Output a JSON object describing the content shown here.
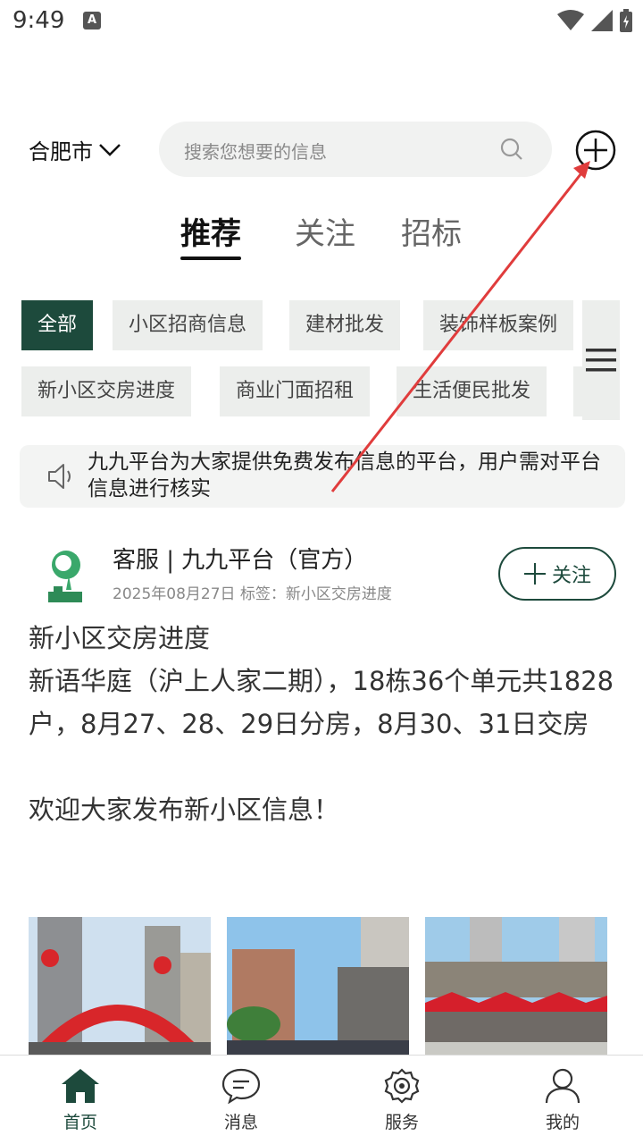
{
  "status_bar": {
    "time": "9:49",
    "badge": "A"
  },
  "header": {
    "city": "合肥市",
    "search_placeholder": "搜索您想要的信息"
  },
  "tabs": [
    {
      "label": "推荐",
      "active": true
    },
    {
      "label": "关注",
      "active": false
    },
    {
      "label": "招标",
      "active": false
    }
  ],
  "categories": [
    "全部",
    "小区招商信息",
    "建材批发",
    "装饰样板案例",
    "新小区交房进度",
    "商业门面招租",
    "生活便民批发"
  ],
  "notice": {
    "text": "九九平台为大家提供免费发布信息的平台，用户需对平台信息进行核实"
  },
  "post": {
    "author": "客服 | 九九平台（官方）",
    "meta": "2025年08月27日 标签：新小区交房进度",
    "follow_label": "关注",
    "body_title": "新小区交房进度",
    "body_text": "新语华庭（沪上人家二期），18栋36个单元共1828户，8月27、28、29日分房，8月30、31日交房",
    "body_footer": "欢迎大家发布新小区信息！"
  },
  "bottom_nav": [
    {
      "label": "首页",
      "icon": "home-icon",
      "active": true
    },
    {
      "label": "消息",
      "icon": "message-icon",
      "active": false
    },
    {
      "label": "服务",
      "icon": "service-icon",
      "active": false
    },
    {
      "label": "我的",
      "icon": "profile-icon",
      "active": false
    }
  ],
  "colors": {
    "brand": "#1d4a3c",
    "annotation": "#e03c3c"
  }
}
